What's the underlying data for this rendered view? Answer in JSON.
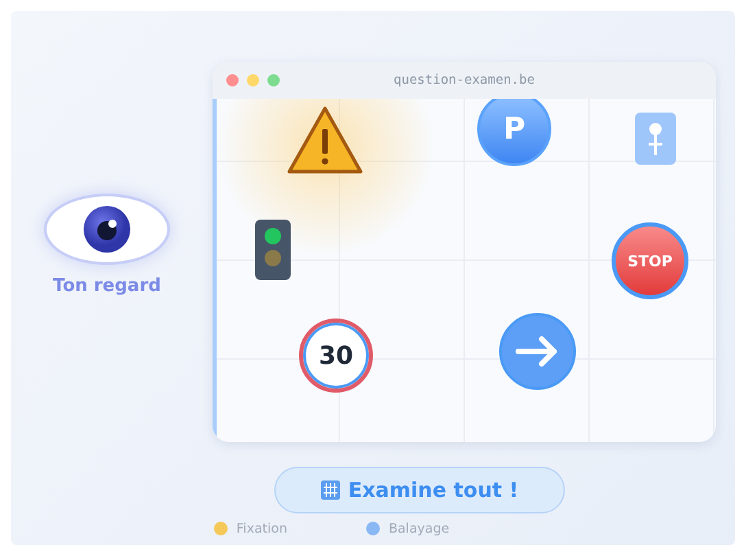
{
  "browser": {
    "address": "question-examen.be"
  },
  "signs": [
    {
      "kind": "warning"
    },
    {
      "kind": "parking",
      "text": "P"
    },
    {
      "kind": "pedestrian"
    },
    {
      "kind": "traffic-light"
    },
    {
      "kind": "stop",
      "text": "STOP"
    },
    {
      "kind": "speed",
      "text": "30"
    },
    {
      "kind": "direction"
    }
  ],
  "viewer": {
    "label": "Ton regard"
  },
  "action": {
    "label": "Examine tout !"
  },
  "legend": [
    {
      "label": "Fixation",
      "color": "#f5c85a"
    },
    {
      "label": "Balayage",
      "color": "#8ab8f5"
    }
  ]
}
